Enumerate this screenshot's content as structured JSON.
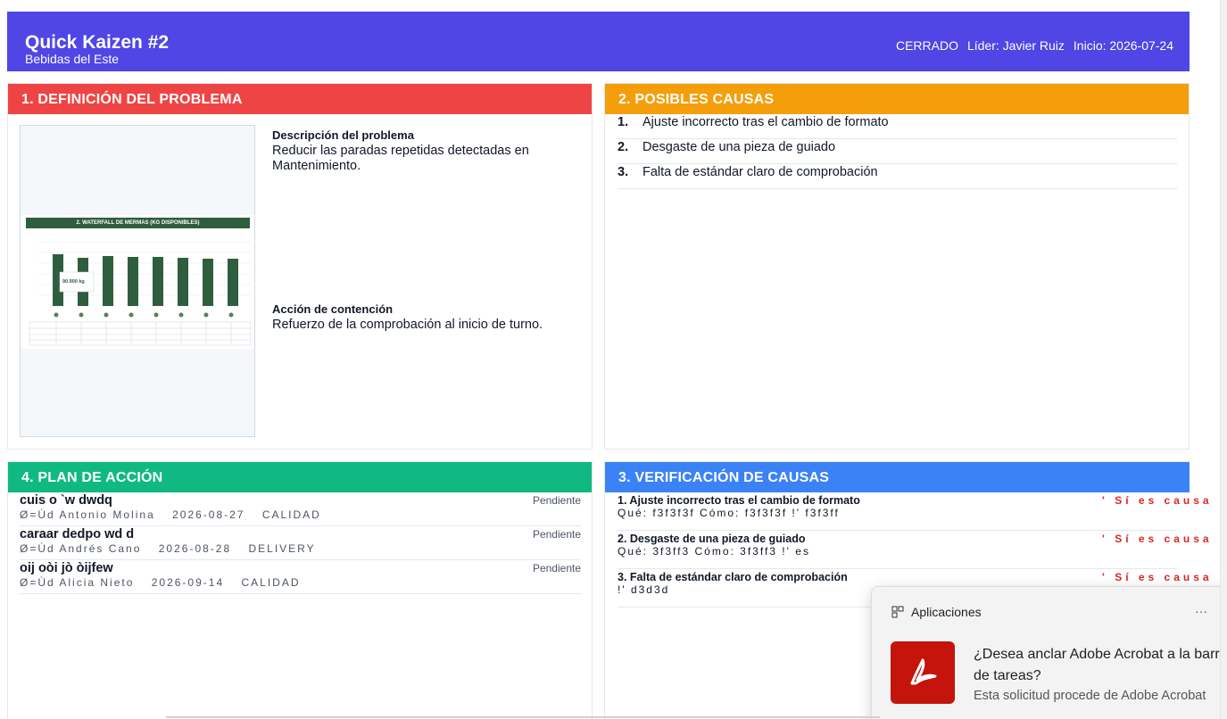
{
  "header": {
    "title": "Quick Kaizen #2",
    "subtitle": "Bebidas del Este",
    "status": "CERRADO",
    "leader": "Líder: Javier Ruiz",
    "start": "Inicio: 2026-07-24"
  },
  "problem": {
    "heading": "1. DEFINICIÓN DEL PROBLEMA",
    "image_title": "2. WATERFALL DE MERMAS (KG DISPONIBLES)",
    "image_callout": "90.900 kg",
    "description_label": "Descripción del problema",
    "description": "Reducir las paradas repetidas detectadas en Mantenimiento.",
    "containment_label": "Acción de contención",
    "containment": "Refuerzo de la comprobación al inicio de turno."
  },
  "causes": {
    "heading": "2. POSIBLES CAUSAS",
    "items": [
      {
        "num": "1.",
        "text": "Ajuste incorrecto tras el cambio de formato"
      },
      {
        "num": "2.",
        "text": "Desgaste de una pieza de guiado"
      },
      {
        "num": "3.",
        "text": "Falta de estándar claro de comprobación"
      }
    ]
  },
  "plan": {
    "heading": "4. PLAN DE ACCIÓN",
    "items": [
      {
        "title": "cuis o `w dwdq",
        "status": "Pendiente",
        "owner": "Ø=Ùd Antonio Molina",
        "date": "2026-08-27",
        "area": "CALIDAD"
      },
      {
        "title": "caraar dedpo wd d",
        "status": "Pendiente",
        "owner": "Ø=Ùd Andrés Cano",
        "date": "2026-08-28",
        "area": "DELIVERY"
      },
      {
        "title": "oij oòi jò òijfew",
        "status": "Pendiente",
        "owner": "Ø=Ùd Alicia Nieto",
        "date": "2026-09-14",
        "area": "CALIDAD"
      }
    ]
  },
  "verification": {
    "heading": "3. VERIFICACIÓN DE CAUSAS",
    "items": [
      {
        "title": "1. Ajuste incorrecto tras el cambio de formato",
        "detail": "Qué: f3f3f3f   Cómo: f3f3f3f   !' f3f3ff",
        "result": "' Sí es causa"
      },
      {
        "title": "2. Desgaste de una pieza de guiado",
        "detail": "Qué: 3f3ff3   Cómo: 3f3ff3   !' es",
        "result": "' Sí es causa"
      },
      {
        "title": "3. Falta de estándar claro de comprobación",
        "detail": "!' d3d3d",
        "result": "' Sí es causa"
      }
    ]
  },
  "toast": {
    "app": "Aplicaciones",
    "menu": "···",
    "message": "¿Desea anclar Adobe Acrobat a la barra de tareas?",
    "source": "Esta solicitud procede de Adobe Acrobat",
    "icon": "adobe-acrobat-icon",
    "icon_color": "#c4140c"
  },
  "colors": {
    "header": "#4f46e5",
    "problem": "#ef4444",
    "causes": "#f59e0b",
    "plan": "#10b981",
    "verification": "#3b82f6"
  }
}
